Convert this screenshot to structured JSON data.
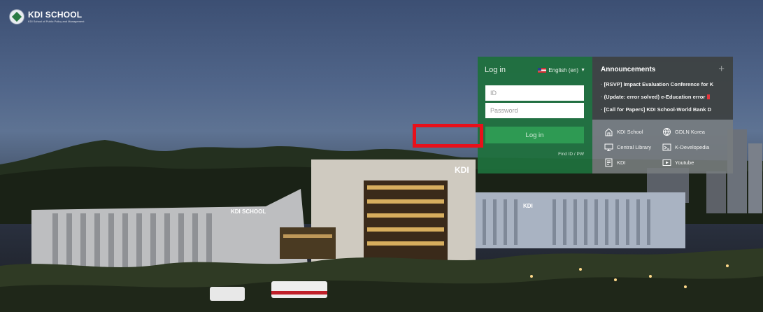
{
  "header": {
    "logo_title": "KDI SCHOOL",
    "logo_subtitle": "KDI School of Public Policy and Management"
  },
  "login": {
    "title": "Log in",
    "language": "English (en)",
    "id_placeholder": "ID",
    "password_placeholder": "Password",
    "login_button": "Log in",
    "find_link": "Find ID / PW"
  },
  "announcements": {
    "title": "Announcements",
    "more": "+",
    "items": [
      "[RSVP] Impact Evaluation Conference for K",
      "(Update: error solved) e-Education error",
      "[Call for Papers] KDI School-World Bank D"
    ]
  },
  "quick_links": {
    "items": [
      {
        "label": "KDI School",
        "icon": "building-icon"
      },
      {
        "label": "GDLN Korea",
        "icon": "globe-icon"
      },
      {
        "label": "Central Library",
        "icon": "monitor-icon"
      },
      {
        "label": "K-Developedia",
        "icon": "kdp-icon"
      },
      {
        "label": "KDI",
        "icon": "kdi-icon"
      },
      {
        "label": "Youtube",
        "icon": "play-icon"
      }
    ]
  },
  "scene": {
    "building_sign_1": "KDI",
    "building_sign_2": "KDI SCHOOL",
    "building_sign_3": "KDI"
  },
  "colors": {
    "login_green": "#1e703c",
    "button_green": "#2e9a53",
    "highlight_red": "#e8101a"
  }
}
